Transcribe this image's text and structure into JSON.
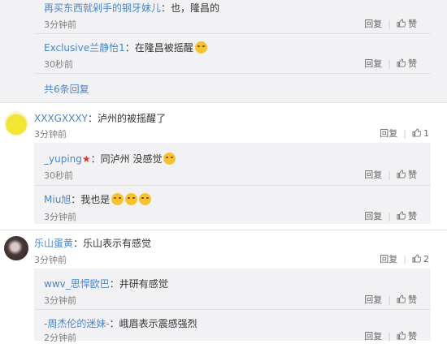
{
  "threads": [
    {
      "replies": [
        {
          "user": "再买东西就剁手的钢牙妹儿",
          "text": "：也，隆昌的",
          "time": "3分钟前",
          "reply": "回复",
          "like": "赞"
        },
        {
          "user": "Exclusive兰静怡1",
          "text": "：在隆昌被摇醒",
          "time": "30秒前",
          "reply": "回复",
          "like": "赞"
        }
      ],
      "more": "共6条回复"
    },
    {
      "user": "XXXGXXXY",
      "text": "：泸州的被摇醒了",
      "time": "3分钟前",
      "reply": "回复",
      "like": "1",
      "replies": [
        {
          "user": "_yuping",
          "text": "：同泸州 没感觉",
          "time": "30秒前",
          "reply": "回复",
          "like": "赞"
        },
        {
          "user": "Miu旭",
          "text": "：我也是",
          "time": "3分钟前",
          "reply": "回复",
          "like": "赞"
        }
      ]
    },
    {
      "user": "乐山蛋黄",
      "text": "：乐山表示有感觉",
      "time": "3分钟前",
      "reply": "回复",
      "like": "2",
      "replies": [
        {
          "user": "wwv_思悍欧巴",
          "text": "：井研有感觉",
          "time": "3分钟前",
          "reply": "回复",
          "like": "赞"
        },
        {
          "user": "-周杰伦的迷妹-",
          "text": "：峨眉表示震感强烈",
          "time": "2分钟前",
          "reply": "回复",
          "like": "赞"
        }
      ]
    }
  ],
  "colors": {
    "link": "#4a86c6",
    "bg_reply": "#f2f2f5",
    "star": "#e2312b"
  },
  "icons": {
    "like": "thumbs-up-icon",
    "star": "star-icon",
    "emoji": "emoji-icon"
  }
}
